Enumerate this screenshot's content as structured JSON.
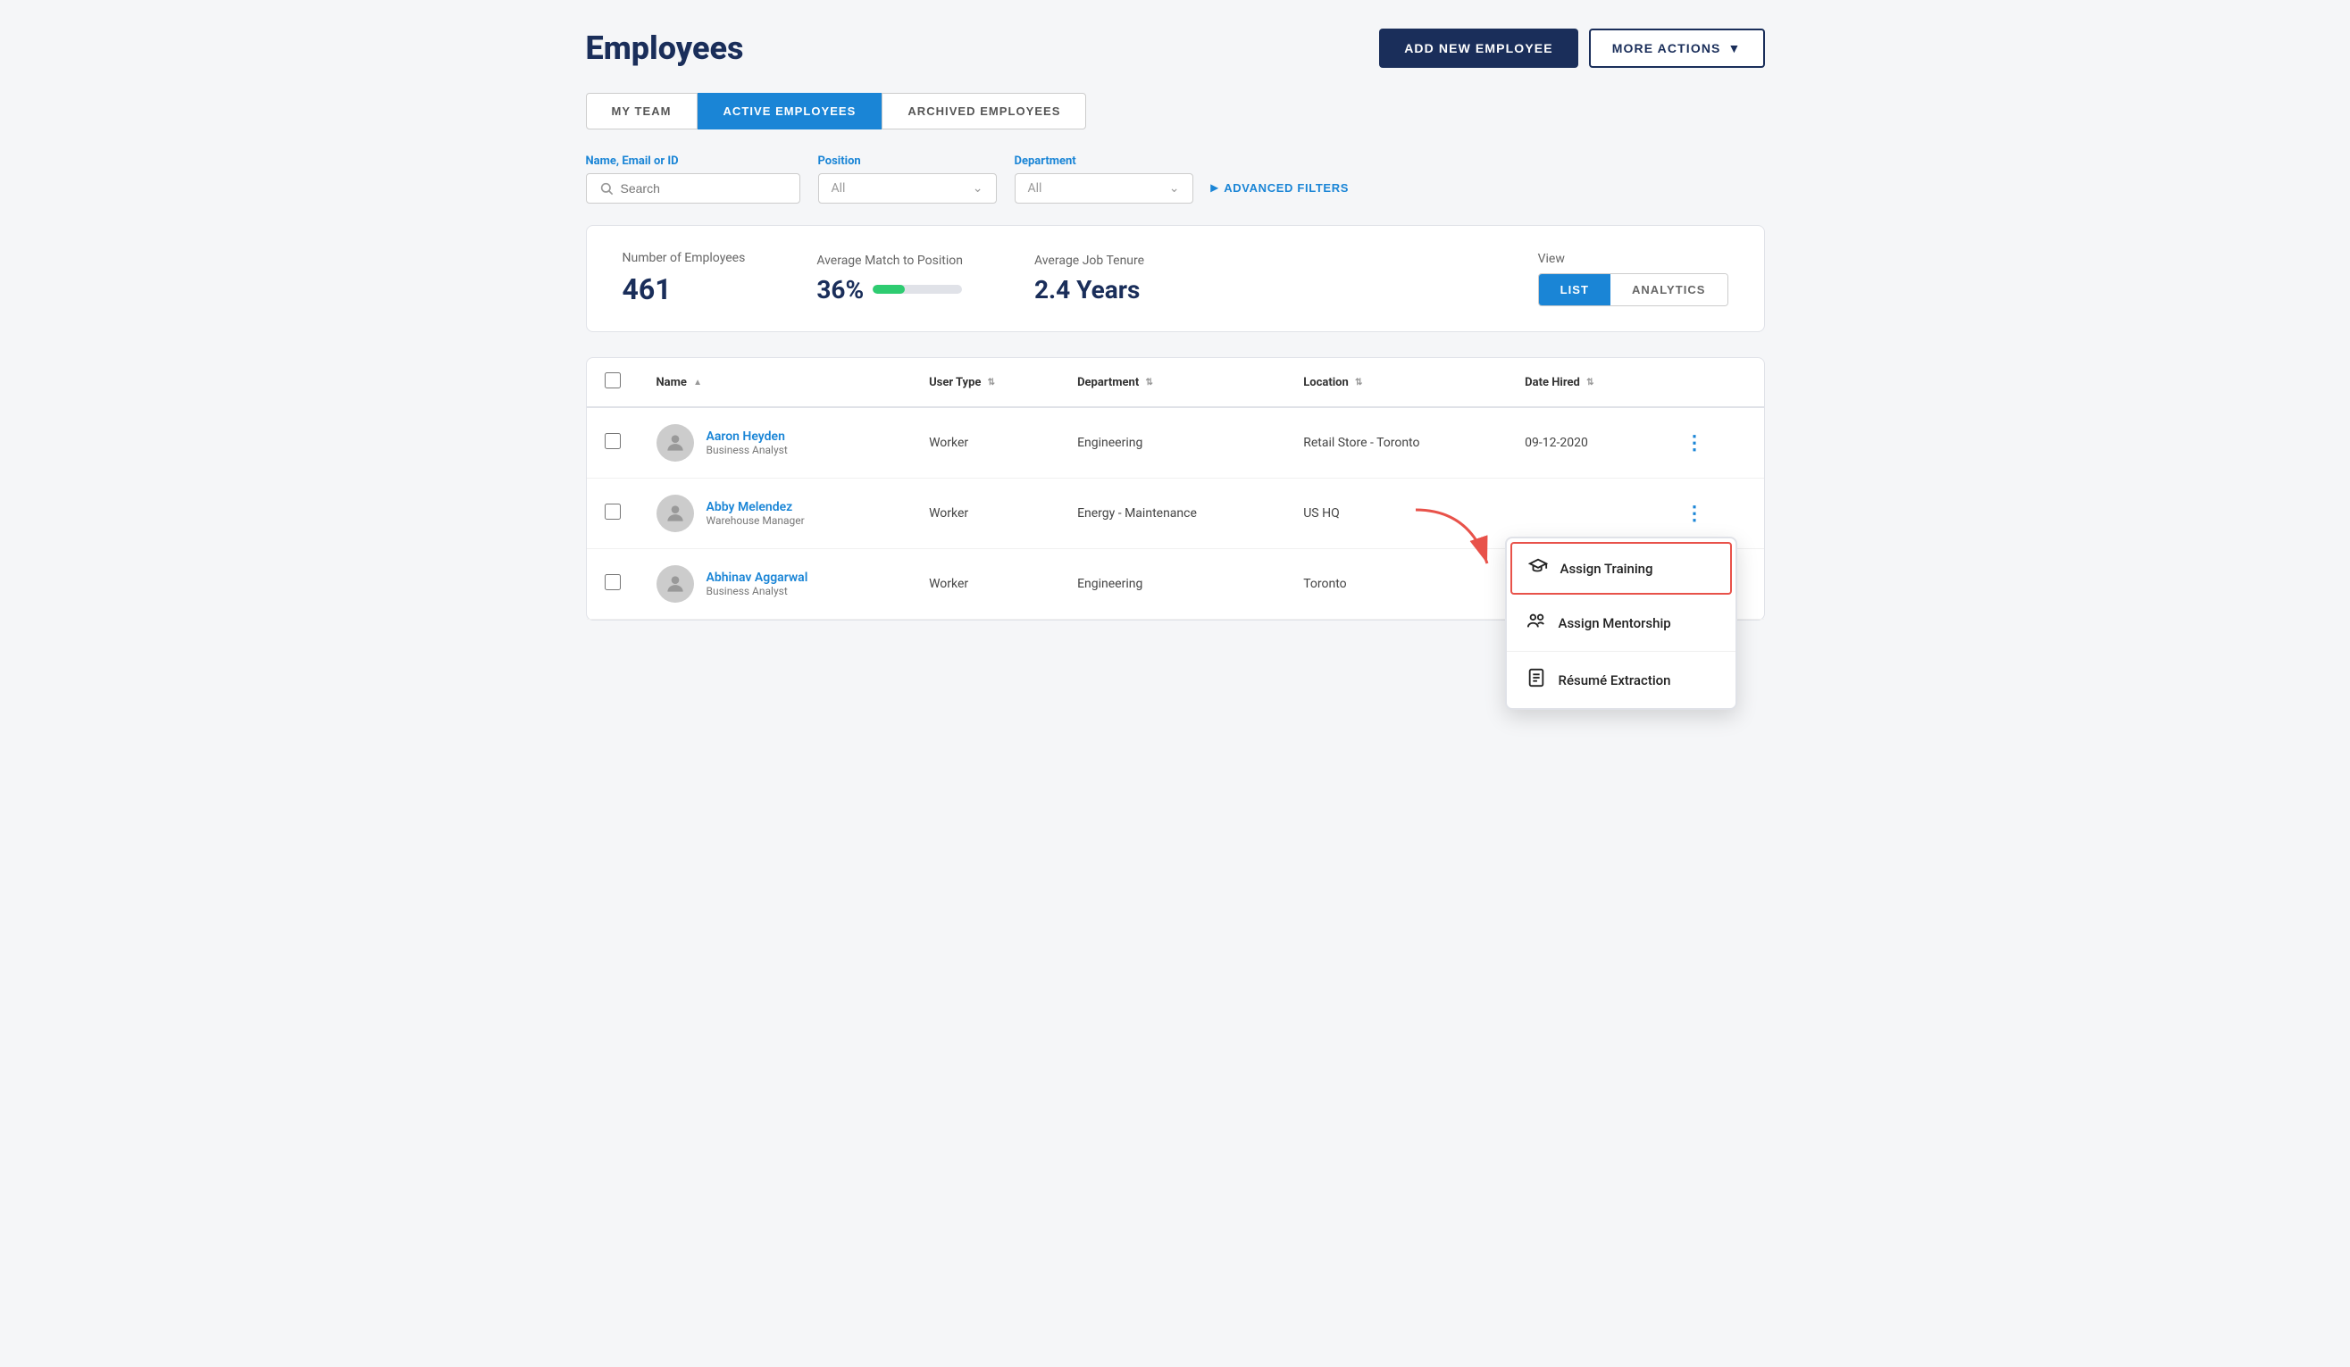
{
  "page": {
    "title": "Employees"
  },
  "header": {
    "add_employee_label": "ADD NEW EMPLOYEE",
    "more_actions_label": "MORE ACTIONS"
  },
  "tabs": [
    {
      "id": "my-team",
      "label": "MY TEAM",
      "active": false
    },
    {
      "id": "active-employees",
      "label": "ACTIVE EMPLOYEES",
      "active": true
    },
    {
      "id": "archived-employees",
      "label": "ARCHIVED EMPLOYEES",
      "active": false
    }
  ],
  "filters": {
    "name_label": "Name, Email or ID",
    "name_placeholder": "Search",
    "position_label": "Position",
    "position_value": "All",
    "department_label": "Department",
    "department_value": "All",
    "advanced_filters_label": "ADVANCED FILTERS"
  },
  "stats": {
    "employee_count_label": "Number of Employees",
    "employee_count_value": "461",
    "match_label": "Average Match to Position",
    "match_value": "36%",
    "match_percent": 36,
    "tenure_label": "Average Job Tenure",
    "tenure_value": "2.4 Years",
    "view_label": "View",
    "list_label": "LIST",
    "analytics_label": "ANALYTICS"
  },
  "table": {
    "columns": [
      {
        "id": "name",
        "label": "Name",
        "sortable": true
      },
      {
        "id": "user-type",
        "label": "User Type",
        "sortable": true
      },
      {
        "id": "department",
        "label": "Department",
        "sortable": true
      },
      {
        "id": "location",
        "label": "Location",
        "sortable": true
      },
      {
        "id": "date-hired",
        "label": "Date Hired",
        "sortable": true
      }
    ],
    "rows": [
      {
        "id": "aaron-heyden",
        "name": "Aaron Heyden",
        "title": "Business Analyst",
        "user_type": "Worker",
        "department": "Engineering",
        "location": "Retail Store - Toronto",
        "date_hired": "09-12-2020"
      },
      {
        "id": "abby-melendez",
        "name": "Abby Melendez",
        "title": "Warehouse Manager",
        "user_type": "Worker",
        "department": "Energy - Maintenance",
        "location": "US HQ",
        "date_hired": ""
      },
      {
        "id": "abhinav-aggarwal",
        "name": "Abhinav Aggarwal",
        "title": "Business Analyst",
        "user_type": "Worker",
        "department": "Engineering",
        "location": "Toronto",
        "date_hired": ""
      }
    ]
  },
  "context_menu": {
    "items": [
      {
        "id": "assign-training",
        "label": "Assign Training",
        "icon": "graduation",
        "highlighted": true
      },
      {
        "id": "assign-mentorship",
        "label": "Assign Mentorship",
        "icon": "mentorship",
        "highlighted": false
      },
      {
        "id": "resume-extraction",
        "label": "Résumé Extraction",
        "icon": "document",
        "highlighted": false
      }
    ]
  }
}
